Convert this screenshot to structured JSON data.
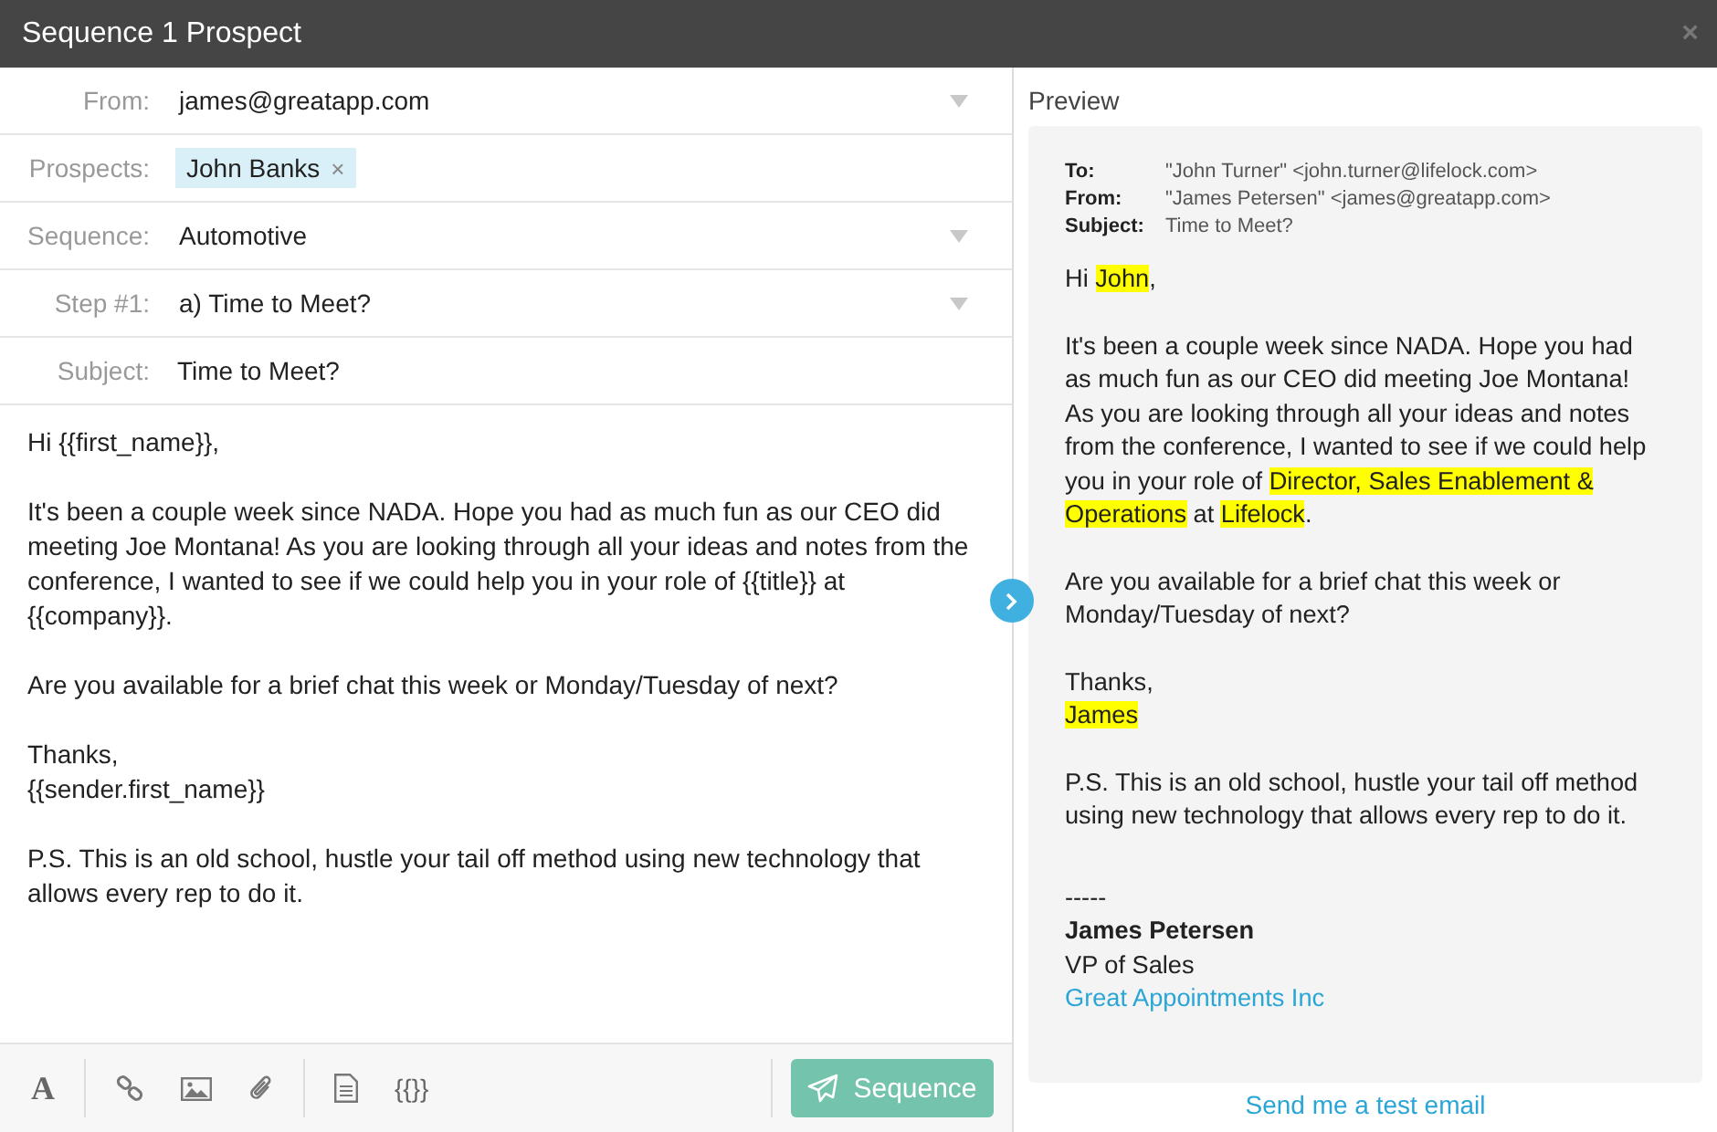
{
  "window": {
    "title": "Sequence 1 Prospect",
    "close": "×"
  },
  "form": [
    {
      "kind": "dropdown",
      "label": "From:",
      "value": "james@greatapp.com"
    },
    {
      "kind": "tags",
      "label": "Prospects:",
      "tags": [
        {
          "text": "John Banks",
          "remove": "×"
        }
      ]
    },
    {
      "kind": "dropdown",
      "label": "Sequence:",
      "value": "Automotive"
    },
    {
      "kind": "dropdown",
      "label": "Step #1:",
      "value": "a) Time to Meet?"
    },
    {
      "kind": "text",
      "label": "Subject:",
      "value": "Time to Meet?"
    }
  ],
  "editor": {
    "paragraphs": [
      "Hi {{first_name}},",
      "It's been a couple week since NADA. Hope you had as much fun as our CEO did meeting Joe Montana! As you are looking through all your ideas and notes from the conference, I wanted to see if we could help you in your role of {{title}} at {{company}}.",
      "Are you available for a brief chat this week or Monday/Tuesday of next?",
      "Thanks,\n{{sender.first_name}}",
      "P.S. This is an old school, hustle your tail off method using new technology that allows every rep to do it."
    ]
  },
  "toolbar": [
    {
      "kind": "glyph",
      "text": "A"
    },
    {
      "kind": "divider"
    },
    {
      "kind": "link"
    },
    {
      "kind": "image"
    },
    {
      "kind": "attach"
    },
    {
      "kind": "divider"
    },
    {
      "kind": "document"
    },
    {
      "kind": "glyph",
      "text": "{{}}"
    }
  ],
  "send_button": {
    "label": "Sequence"
  },
  "preview": {
    "title": "Preview",
    "headers": [
      {
        "label": "To:",
        "value": "\"John Turner\" <john.turner@lifelock.com>"
      },
      {
        "label": "From:",
        "value": "\"James Petersen\" <james@greatapp.com>"
      },
      {
        "label": "Subject:",
        "value": "Time to Meet?"
      }
    ],
    "paragraphs": [
      [
        {
          "text": "Hi ",
          "highlight": false
        },
        {
          "text": "John",
          "highlight": true
        },
        {
          "text": ",",
          "highlight": false
        }
      ],
      [
        {
          "text": "It's been a couple week since NADA. Hope you had as much fun as our CEO did meeting Joe Montana! As you are looking through all your ideas and notes from the conference, I wanted to see if we could help you in your role of ",
          "highlight": false
        },
        {
          "text": "Director, Sales Enablement & Operations",
          "highlight": true
        },
        {
          "text": " at ",
          "highlight": false
        },
        {
          "text": "Lifelock",
          "highlight": true
        },
        {
          "text": ".",
          "highlight": false
        }
      ],
      [
        {
          "text": "Are you available for a brief chat this week or Monday/Tuesday of next?",
          "highlight": false
        }
      ],
      [
        {
          "text": "Thanks,\n",
          "highlight": false
        },
        {
          "text": "James",
          "highlight": true
        }
      ],
      [
        {
          "text": "P.S. This is an old school, hustle your tail off method using new technology that allows every rep to do it.",
          "highlight": false
        }
      ]
    ],
    "signature": {
      "rule": "-----",
      "name": "James Petersen",
      "role": "VP of Sales",
      "company": "Great Appointments Inc"
    },
    "test_link": "Send me a test email"
  }
}
